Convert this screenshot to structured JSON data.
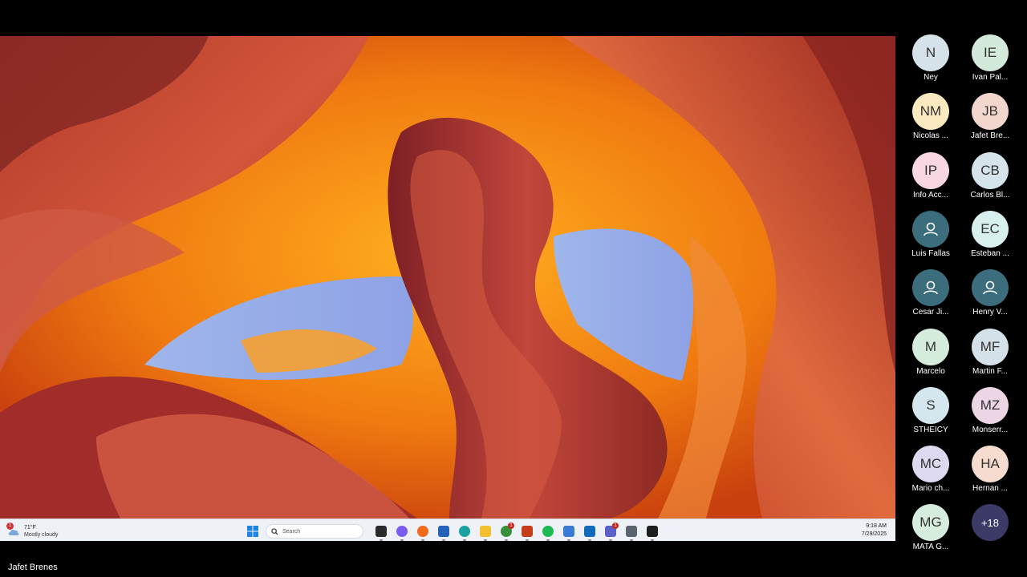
{
  "taskbar": {
    "weather": {
      "temp": "71°F",
      "condition": "Mostly cloudy",
      "badge": "1"
    },
    "search_placeholder": "Search",
    "time": "9:18 AM",
    "date": "7/29/2025",
    "apps": [
      {
        "name": "task-view-icon",
        "color": "#2b2b2b"
      },
      {
        "name": "copilot-icon",
        "color": "#7b5cf0"
      },
      {
        "name": "firefox-icon",
        "color": "#f26a1b"
      },
      {
        "name": "store-icon",
        "color": "#2563b8"
      },
      {
        "name": "edge-icon",
        "color": "#1aa1a0"
      },
      {
        "name": "file-explorer-icon",
        "color": "#f4c02f"
      },
      {
        "name": "chrome-icon",
        "color": "#3a8f3a",
        "badge": "1"
      },
      {
        "name": "powerpoint-icon",
        "color": "#c43e1c"
      },
      {
        "name": "spotify-icon",
        "color": "#1db954"
      },
      {
        "name": "notepad-icon",
        "color": "#3a7bd5"
      },
      {
        "name": "outlook-icon",
        "color": "#0f6cbd"
      },
      {
        "name": "teams-icon",
        "color": "#5b5fc7",
        "badge": "1"
      },
      {
        "name": "settings-icon",
        "color": "#5a6470"
      },
      {
        "name": "terminal-icon",
        "color": "#1e1e1e"
      }
    ]
  },
  "participants": [
    {
      "initials": "N",
      "name": "Ney",
      "bg": "#d6e2ea"
    },
    {
      "initials": "IE",
      "name": "Ivan Pal...",
      "bg": "#d3eadb"
    },
    {
      "initials": "NM",
      "name": "Nicolas ...",
      "bg": "#fbeac0"
    },
    {
      "initials": "JB",
      "name": "Jafet Bre...",
      "bg": "#f3d6cd"
    },
    {
      "initials": "IP",
      "name": "Info Acc...",
      "bg": "#f8d7e2"
    },
    {
      "initials": "CB",
      "name": "Carlos Bl...",
      "bg": "#d4e4ea"
    },
    {
      "initials": "",
      "name": "Luis Fallas",
      "bg": "#3b6d7d",
      "generic": true
    },
    {
      "initials": "EC",
      "name": "Esteban ...",
      "bg": "#d7f0ee"
    },
    {
      "initials": "",
      "name": "Cesar Ji...",
      "bg": "#3b6d7d",
      "generic": true
    },
    {
      "initials": "",
      "name": "Henry V...",
      "bg": "#3b6d7d",
      "generic": true
    },
    {
      "initials": "M",
      "name": "Marcelo",
      "bg": "#d4ecdc"
    },
    {
      "initials": "MF",
      "name": "Martin F...",
      "bg": "#d4e1e8"
    },
    {
      "initials": "S",
      "name": "STHEICY",
      "bg": "#d5e7ee"
    },
    {
      "initials": "MZ",
      "name": "Monserr...",
      "bg": "#ecd6e6"
    },
    {
      "initials": "MC",
      "name": "Mario ch...",
      "bg": "#dcd9f0"
    },
    {
      "initials": "HA",
      "name": "Hernan ...",
      "bg": "#f5dccf"
    },
    {
      "initials": "MG",
      "name": "MATA G...",
      "bg": "#d6ecdd"
    },
    {
      "initials": "+18",
      "name": "",
      "bg": "#3c3a67",
      "more": true
    }
  ],
  "self_name": "Jafet Brenes"
}
